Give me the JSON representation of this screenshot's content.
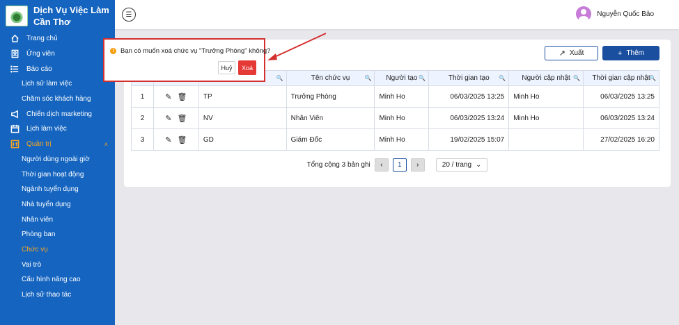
{
  "brand": {
    "title_line1": "Dịch Vụ Việc Làm",
    "title_line2": "Cần Thơ"
  },
  "sidebar": {
    "items": [
      {
        "label": "Trang chủ",
        "icon": "home-icon"
      },
      {
        "label": "Ứng viên",
        "icon": "candidate-icon"
      },
      {
        "label": "Báo cáo",
        "icon": "list-icon"
      },
      {
        "label": "Lịch sử làm việc",
        "sub": true
      },
      {
        "label": "Chăm sóc khách hàng",
        "sub": true
      },
      {
        "label": "Chiến dịch marketing",
        "icon": "megaphone-icon"
      },
      {
        "label": "Lịch làm việc",
        "icon": "calendar-icon"
      },
      {
        "label": "Quản trị",
        "icon": "admin-icon",
        "open": true
      },
      {
        "label": "Người dùng ngoài giờ",
        "sub": true
      },
      {
        "label": "Thời gian hoạt động",
        "sub": true
      },
      {
        "label": "Ngành tuyển dụng",
        "sub": true
      },
      {
        "label": "Nhà tuyển dụng",
        "sub": true
      },
      {
        "label": "Nhân viên",
        "sub": true
      },
      {
        "label": "Phòng ban",
        "sub": true
      },
      {
        "label": "Chức vụ",
        "sub": true,
        "active": true
      },
      {
        "label": "Vai trò",
        "sub": true
      },
      {
        "label": "Cấu hình nâng cao",
        "sub": true
      },
      {
        "label": "Lịch sử thao tác",
        "sub": true
      }
    ]
  },
  "header": {
    "user_name": "Nguyễn Quốc Bảo"
  },
  "toolbar": {
    "export_label": "Xuất",
    "add_label": "Thêm"
  },
  "table": {
    "headers": [
      "Tên chức vụ",
      "Người tạo",
      "Thời gian tạo",
      "Người cập nhật",
      "Thời gian cập nhật"
    ],
    "rows": [
      {
        "stt": "1",
        "code": "TP",
        "name": "Trưởng Phòng",
        "creator": "Minh Ho",
        "created": "06/03/2025 13:25",
        "updater": "Minh Ho",
        "updated": "06/03/2025 13:25"
      },
      {
        "stt": "2",
        "code": "NV",
        "name": "Nhân Viên",
        "creator": "Minh Ho",
        "created": "06/03/2025 13:24",
        "updater": "Minh Ho",
        "updated": "06/03/2025 13:24"
      },
      {
        "stt": "3",
        "code": "GD",
        "name": "Giám Đốc",
        "creator": "Minh Ho",
        "created": "19/02/2025 15:07",
        "updater": "",
        "updated": "27/02/2025 16:20"
      }
    ]
  },
  "pagination": {
    "total_text": "Tổng cộng 3 bản ghi",
    "current_page": "1",
    "page_size": "20 / trang"
  },
  "confirm": {
    "message": "Bạn có muốn xoá chức vụ \"Trưởng Phòng\" không?",
    "cancel_label": "Huỷ",
    "ok_label": "Xoá"
  },
  "colors": {
    "sidebar": "#1565c0",
    "primary": "#1a4fa0",
    "danger": "#e53935",
    "active": "#f5a623"
  }
}
